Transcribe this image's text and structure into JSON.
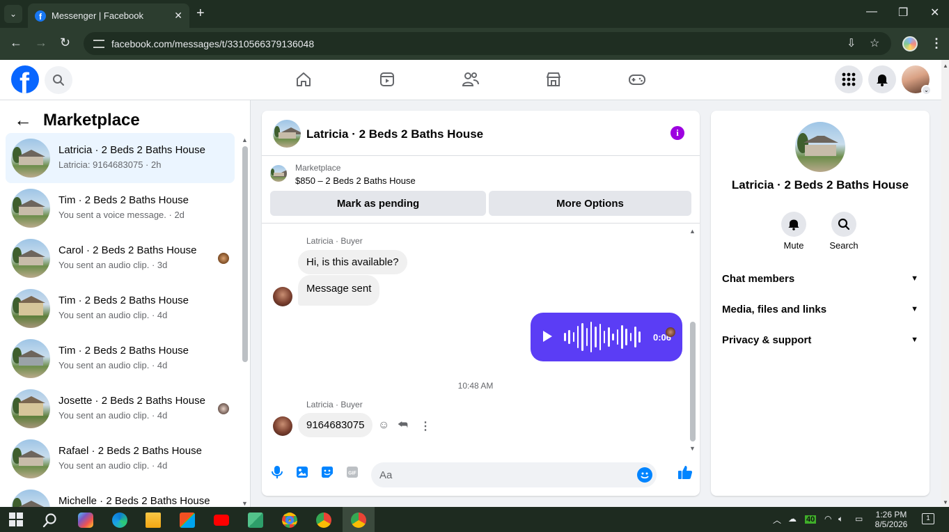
{
  "browser": {
    "tab_title": "Messenger | Facebook",
    "url": "facebook.com/messages/t/3310566379136048"
  },
  "header": {
    "logo_letter": "f",
    "nav_icons": [
      "home-icon",
      "video-icon",
      "friends-icon",
      "marketplace-icon",
      "gaming-icon"
    ],
    "right_icons": [
      "menu-grid-icon",
      "notifications-bell-icon",
      "profile-avatar"
    ]
  },
  "sidebar": {
    "title": "Marketplace",
    "conversations": [
      {
        "name": "Latricia · 2 Beds 2 Baths House",
        "preview": "Latricia: 9164683075 · 2h",
        "active": true
      },
      {
        "name": "Tim · 2 Beds 2 Baths House",
        "preview": "You sent a voice message. · 2d"
      },
      {
        "name": "Carol · 2 Beds 2 Baths House",
        "preview": "You sent an audio clip. · 3d"
      },
      {
        "name": "Tim · 2 Beds 2 Baths House",
        "preview": "You sent an audio clip. · 4d"
      },
      {
        "name": "Tim · 2 Beds 2 Baths House",
        "preview": "You sent an audio clip. · 4d"
      },
      {
        "name": "Josette · 2 Beds 2 Baths House",
        "preview": "You sent an audio clip. · 4d"
      },
      {
        "name": "Rafael · 2 Beds 2 Baths House",
        "preview": "You sent an audio clip. · 4d"
      },
      {
        "name": "Michelle · 2 Beds 2 Baths House",
        "preview": ""
      }
    ]
  },
  "chat": {
    "title": "Latricia · 2 Beds 2 Baths House",
    "marketplace_label": "Marketplace",
    "listing": "$850 – 2 Beds 2 Baths House",
    "mark_pending": "Mark as pending",
    "more_options": "More Options",
    "messages": {
      "sender1": "Latricia · Buyer",
      "msg1": "Hi, is this available?",
      "msg2": "Message sent",
      "voice_duration": "0:06",
      "timestamp": "10:48 AM",
      "sender2": "Latricia · Buyer",
      "msg3": "9164683075"
    },
    "composer_placeholder": "Aa"
  },
  "details": {
    "name": "Latricia · 2 Beds 2 Baths House",
    "mute": "Mute",
    "search": "Search",
    "sections": [
      "Chat members",
      "Media, files and links",
      "Privacy & support"
    ]
  },
  "taskbar": {
    "temp_badge": "40",
    "time": "1:26 PM",
    "date": "8/5/2026",
    "notif_count": "1"
  },
  "colors": {
    "fb_blue": "#0866ff",
    "voice_bubble": "#5b3df5",
    "info_purple": "#9d00e0",
    "active_row": "#ebf5ff"
  }
}
